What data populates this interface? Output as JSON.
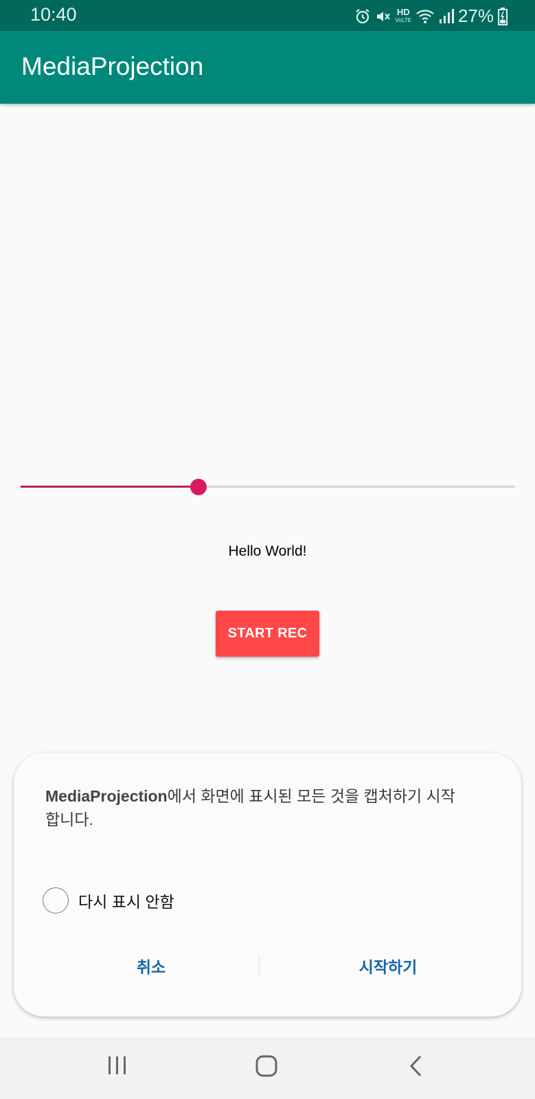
{
  "status_bar": {
    "time": "10:40",
    "battery": "27%",
    "hd_label": "HD",
    "hd_sub": "VoLTE"
  },
  "app_bar": {
    "title": "MediaProjection"
  },
  "slider": {
    "value": 0.36
  },
  "main": {
    "hello_text": "Hello World!",
    "start_button": "START REC"
  },
  "dialog": {
    "app_name": "MediaProjection",
    "message_rest": "에서 화면에 표시된 모든 것을 캡처하기 시작합니다.",
    "checkbox_label": "다시 표시 안함",
    "cancel_label": "취소",
    "start_label": "시작하기"
  },
  "colors": {
    "status_bar": "#00695c",
    "app_bar": "#00897b",
    "accent": "#d81b60",
    "button": "#ff4747",
    "dialog_button": "#1565a9"
  },
  "icons": [
    "alarm-icon",
    "mute-icon",
    "wifi-icon",
    "signal-icon",
    "battery-icon",
    "recents-icon",
    "home-icon",
    "back-icon"
  ]
}
